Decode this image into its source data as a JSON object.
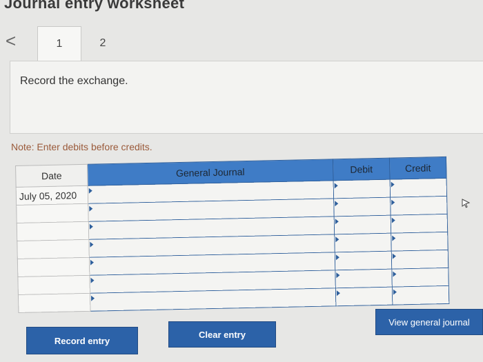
{
  "header": {
    "title": "Journal entry worksheet"
  },
  "nav": {
    "prev_icon": "chevron-left-icon",
    "prev_glyph": "<"
  },
  "tabs": [
    {
      "label": "1",
      "active": true
    },
    {
      "label": "2",
      "active": false
    }
  ],
  "instruction": {
    "text": "Record the exchange."
  },
  "note": {
    "text": "Note: Enter debits before credits."
  },
  "journal": {
    "headers": {
      "date": "Date",
      "general_journal": "General Journal",
      "debit": "Debit",
      "credit": "Credit"
    },
    "rows": [
      {
        "date": "July 05, 2020",
        "account": "",
        "debit": "",
        "credit": ""
      },
      {
        "date": "",
        "account": "",
        "debit": "",
        "credit": ""
      },
      {
        "date": "",
        "account": "",
        "debit": "",
        "credit": ""
      },
      {
        "date": "",
        "account": "",
        "debit": "",
        "credit": ""
      },
      {
        "date": "",
        "account": "",
        "debit": "",
        "credit": ""
      },
      {
        "date": "",
        "account": "",
        "debit": "",
        "credit": ""
      },
      {
        "date": "",
        "account": "",
        "debit": "",
        "credit": ""
      }
    ]
  },
  "buttons": {
    "record": "Record entry",
    "clear": "Clear entry",
    "view": "View general journal"
  },
  "colors": {
    "header_blue": "#3f7cc6",
    "button_blue": "#2c62a8",
    "note": "#9a5a3a"
  }
}
